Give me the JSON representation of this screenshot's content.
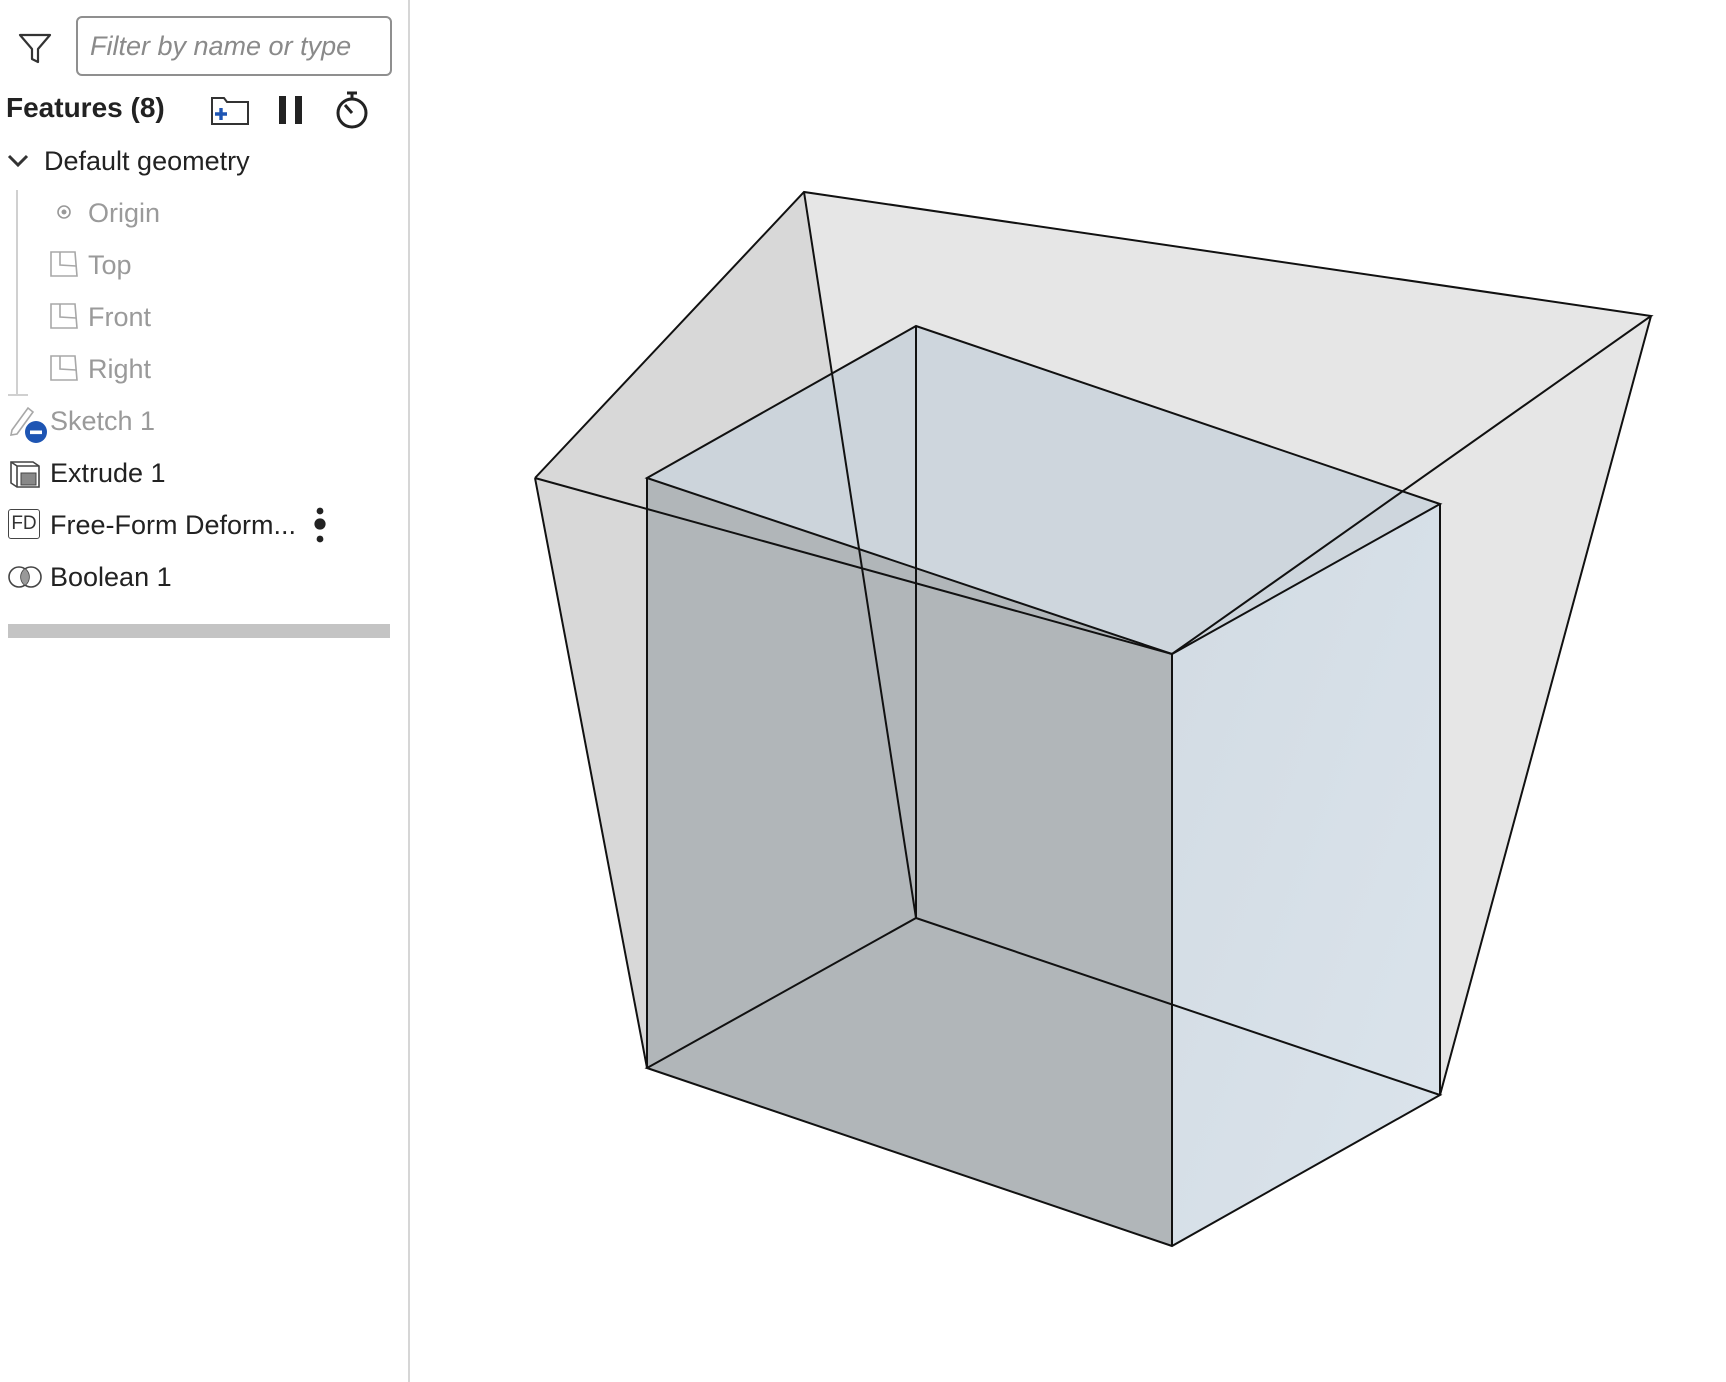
{
  "filter": {
    "placeholder": "Filter by name or type"
  },
  "features": {
    "title": "Features (8)"
  },
  "tree": {
    "group": {
      "label": "Default geometry"
    },
    "default_items": [
      {
        "label": "Origin",
        "icon": "origin-point-icon"
      },
      {
        "label": "Top",
        "icon": "plane-icon"
      },
      {
        "label": "Front",
        "icon": "plane-icon"
      },
      {
        "label": "Right",
        "icon": "plane-icon"
      }
    ],
    "items": [
      {
        "label": "Sketch 1",
        "icon": "sketch-hidden-icon",
        "state": "hidden"
      },
      {
        "label": "Extrude 1",
        "icon": "extrude-icon"
      },
      {
        "label": "Free-Form Deform...",
        "icon": "free-form-deform-icon",
        "icon_text": "FD"
      },
      {
        "label": "Boolean 1",
        "icon": "boolean-icon"
      }
    ]
  },
  "colors": {
    "accent": "#1e55b3",
    "dim_text": "#9a9a9a",
    "box_light": "#d5dfe7",
    "box_dark": "#b0b5b8",
    "hull": "#e3e3e3"
  }
}
